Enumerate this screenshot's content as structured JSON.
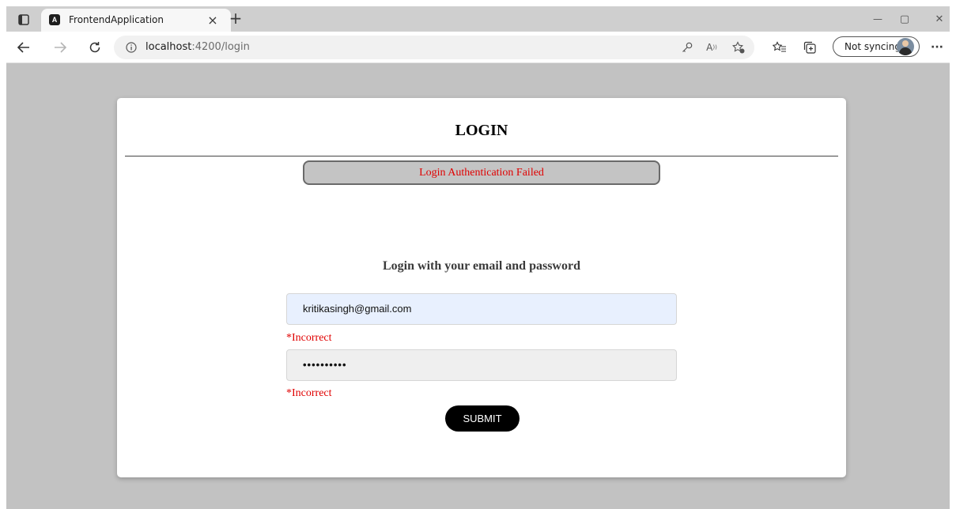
{
  "browser": {
    "tab": {
      "title": "FrontendApplication",
      "logo_letter": "A",
      "close": "×"
    },
    "new_tab": "+",
    "window_controls": {
      "minimize": "—",
      "restore": "▢",
      "close": "✕"
    },
    "address": {
      "host": "localhost",
      "rest": ":4200/login"
    },
    "sync_label": "Not syncing",
    "more": "···"
  },
  "login": {
    "title": "LOGIN",
    "alert": "Login Authentication Failed",
    "subtitle": "Login with your email and password",
    "email_value": "kritikasingh@gmail.com",
    "email_error": "*Incorrect",
    "password_value": "••••••••••",
    "password_error": "*Incorrect",
    "submit_label": "SUBMIT"
  },
  "colors": {
    "error": "#e00000",
    "viewport_bg": "#c2c2c2",
    "button": "#000000"
  }
}
